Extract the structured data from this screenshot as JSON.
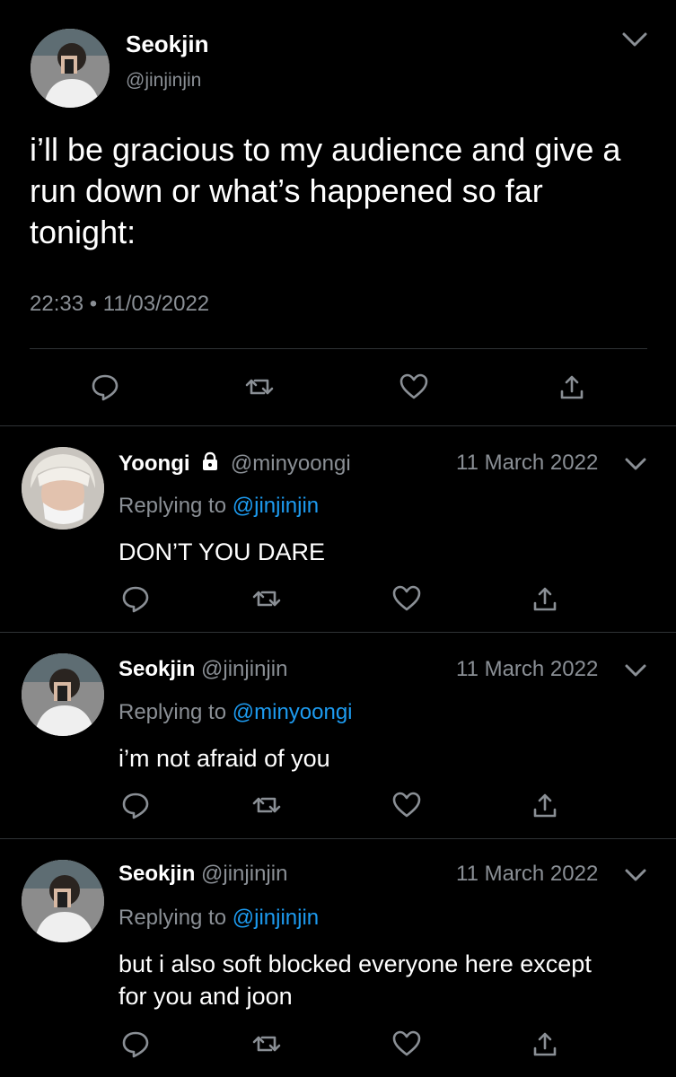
{
  "main_tweet": {
    "name": "Seokjin",
    "handle": "@jinjinjin",
    "text": "i’ll be gracious to my audience and give a run down or what’s happened so far tonight:",
    "time": "22:33 • 11/03/2022"
  },
  "replies": [
    {
      "name": "Yoongi",
      "handle": "@minyoongi",
      "locked": true,
      "date": "11 March 2022",
      "replying_prefix": "Replying to",
      "replying_to": "@jinjinjin",
      "text": "DON’T YOU DARE"
    },
    {
      "name": "Seokjin",
      "handle": "@jinjinjin",
      "locked": false,
      "date": "11 March 2022",
      "replying_prefix": "Replying to",
      "replying_to": "@minyoongi",
      "text": "i’m not afraid of you"
    },
    {
      "name": "Seokjin",
      "handle": "@jinjinjin",
      "locked": false,
      "date": "11 March 2022",
      "replying_prefix": "Replying to",
      "replying_to": "@jinjinjin",
      "text": "but i also soft blocked everyone here except for you and joon"
    }
  ],
  "icons": {
    "reply": "reply-icon",
    "retweet": "retweet-icon",
    "like": "heart-icon",
    "share": "share-icon",
    "more": "chevron-down-icon",
    "lock": "lock-icon"
  },
  "colors": {
    "background": "#000000",
    "link": "#1d9bf0",
    "muted": "#8a8f95",
    "divider": "#2f3336"
  }
}
